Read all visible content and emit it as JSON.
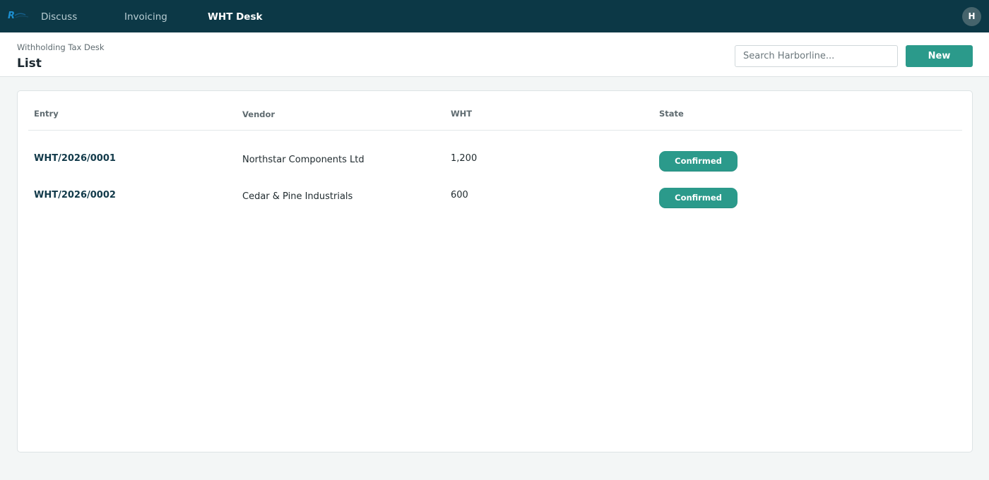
{
  "colors": {
    "topbar": "#0c3846",
    "accent": "#2b9a8b",
    "page_background": "#f3f6f6",
    "avatar": "#46646c"
  },
  "topbar": {
    "logo_icon": "company-logo-icon",
    "nav": [
      {
        "label": "Discuss",
        "active": false
      },
      {
        "label": "Invoicing",
        "active": false
      },
      {
        "label": "WHT Desk",
        "active": true
      }
    ],
    "user_initial": "H"
  },
  "control_panel": {
    "breadcrumb": "Withholding Tax Desk",
    "title": "List",
    "search_placeholder": "Search Harborline...",
    "search_value": "",
    "new_label": "New"
  },
  "list": {
    "columns": [
      "Entry",
      "Vendor",
      "WHT",
      "State"
    ],
    "rows": [
      {
        "entry": "WHT/2026/0001",
        "vendor": "Northstar Components Ltd",
        "wht": "1,200",
        "state": "Confirmed"
      },
      {
        "entry": "WHT/2026/0002",
        "vendor": "Cedar & Pine Industrials",
        "wht": "600",
        "state": "Confirmed"
      }
    ]
  }
}
